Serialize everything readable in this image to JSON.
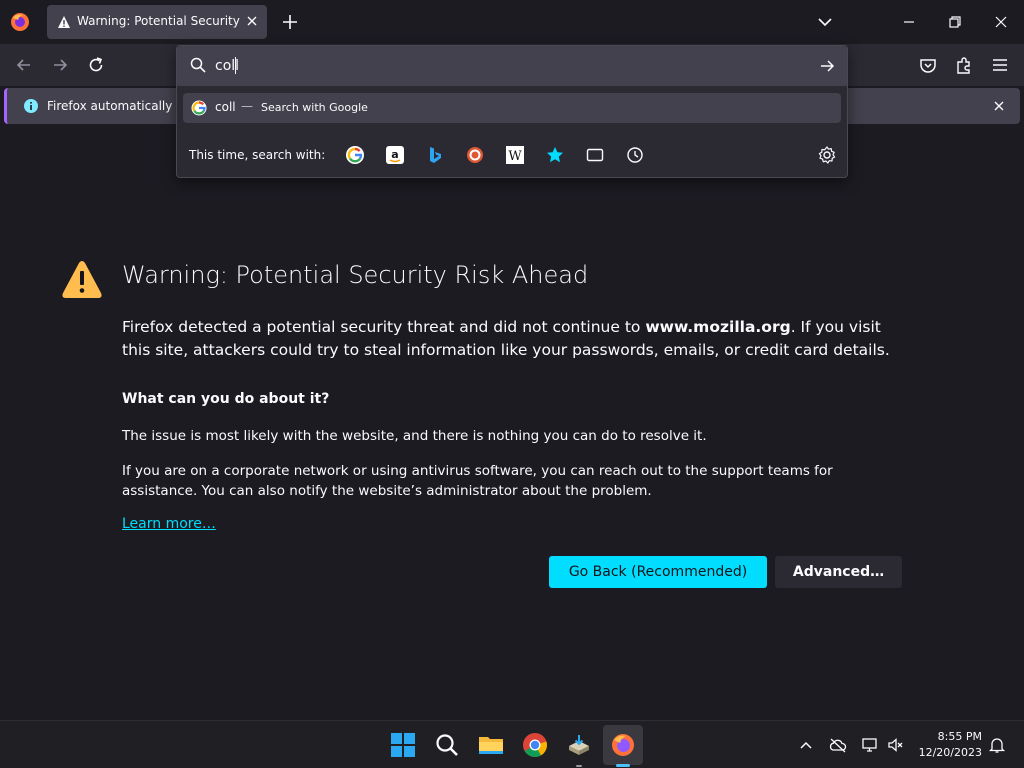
{
  "tab": {
    "title": "Warning: Potential Security Risk Ahead"
  },
  "notification": {
    "text": "Firefox automatically sen"
  },
  "urlbar": {
    "value": "coll",
    "suggestion": {
      "term": "coll",
      "separator": "—",
      "action": "Search with Google"
    },
    "search_with_label": "This time, search with:",
    "engines": [
      "google-icon",
      "amazon-icon",
      "bing-icon",
      "duckduckgo-icon",
      "wikipedia-icon",
      "bookmarks-icon",
      "tabs-icon",
      "history-icon"
    ]
  },
  "error_page": {
    "title": "Warning: Potential Security Risk Ahead",
    "desc_before": "Firefox detected a potential security threat and did not continue to ",
    "desc_site": "www.mozilla.org",
    "desc_after": ". If you visit this site, attackers could try to steal information like your passwords, emails, or credit card details.",
    "heading": "What can you do about it?",
    "para1": "The issue is most likely with the website, and there is nothing you can do to resolve it.",
    "para2": "If you are on a corporate network or using antivirus software, you can reach out to the support teams for assistance. You can also notify the website’s administrator about the problem.",
    "learn_more": "Learn more…",
    "go_back_label": "Go Back (Recommended)",
    "advanced_label": "Advanced…"
  },
  "taskbar": {
    "apps": [
      "windows-start-icon",
      "search-icon",
      "file-explorer-icon",
      "chrome-icon",
      "app-installer-icon",
      "firefox-icon"
    ],
    "time": "8:55 PM",
    "date": "12/20/2023"
  },
  "colors": {
    "accent": "#00ddff",
    "warning": "#ffbd4f",
    "background": "#1c1b22",
    "toolbar": "#2b2a33"
  }
}
